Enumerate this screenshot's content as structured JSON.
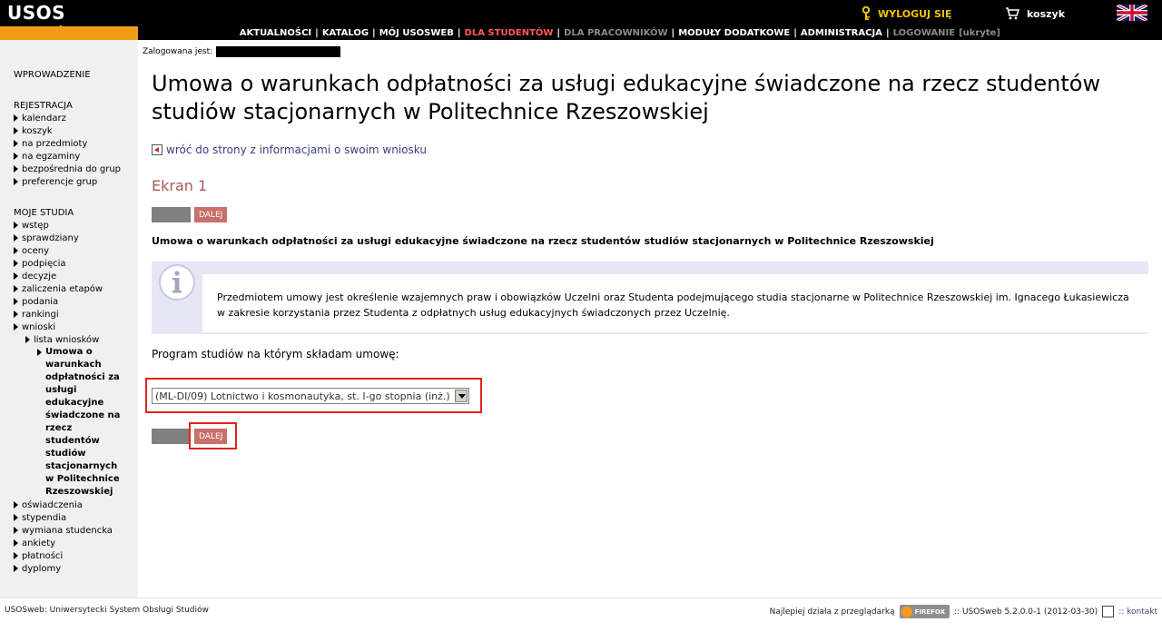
{
  "header": {
    "logo_main": "USOS",
    "logo_sub": "web",
    "logout_label": "WYLOGUJ SIĘ",
    "cart_label": "koszyk",
    "nav": [
      {
        "label": "AKTUALNOŚCI"
      },
      {
        "label": "KATALOG"
      },
      {
        "label": "MÓJ USOSWEB"
      },
      {
        "label": "DLA STUDENTÓW"
      },
      {
        "label": "DLA PRACOWNIKÓW"
      },
      {
        "label": "MODUŁY DODATKOWE"
      },
      {
        "label": "ADMINISTRACJA"
      },
      {
        "label": "LOGOWANIE"
      }
    ],
    "nav_hidden_tag": "[ukryte]",
    "colors": {
      "accent": "#f29b18",
      "active": "#ff5a5a",
      "inactive": "#8a8a8a"
    }
  },
  "sidebar": {
    "intro": "WPROWADZENIE",
    "registration_header": "REJESTRACJA",
    "registration_items": [
      "kalendarz",
      "koszyk",
      "na przedmioty",
      "na egzaminy",
      "bezpośrednia do grup",
      "preferencje grup"
    ],
    "studies_header": "MOJE STUDIA",
    "studies_items": [
      "wstęp",
      "sprawdziany",
      "oceny",
      "podpięcia",
      "decyzje",
      "zaliczenia etapów",
      "podania",
      "rankingi",
      "wnioski"
    ],
    "sub_item": "lista wniosków",
    "current_lines": [
      "Umowa o",
      "warunkach",
      "odpłatności za",
      "usługi",
      "edukacyjne",
      "świadczone na",
      "rzecz",
      "studentów",
      "studiów",
      "stacjonarnych",
      "w Politechnice",
      "Rzeszowskiej"
    ],
    "after_items": [
      "oświadczenia",
      "stypendia",
      "wymiana studencka",
      "ankiety",
      "płatności",
      "dyplomy"
    ]
  },
  "main": {
    "logged_label": "Zalogowana jest:",
    "title": "Umowa o warunkach odpłatności za usługi edukacyjne świadczone na rzecz studentów studiów stacjonarnych w Politechnice Rzeszowskiej",
    "back_link": "wróć do strony z informacjami o swoim wniosku",
    "screen_heading": "Ekran 1",
    "next_label": "DALEJ",
    "subtitle": "Umowa o warunkach odpłatności za usługi edukacyjne świadczone na rzecz studentów studiów stacjonarnych w Politechnice Rzeszowskiej",
    "info_text": "Przedmiotem umowy jest określenie wzajemnych praw i obowiązków Uczelni oraz Studenta podejmującego studia stacjonarne w Politechnice Rzeszowskiej im. Ignacego Łukasiewicza w zakresie korzystania przez Studenta z odpłatnych usług edukacyjnych świadczonych przez Uczelnię.",
    "program_label": "Program studiów na którym składam umowę:",
    "program_selected": "(ML-DI/09) Lotnictwo i kosmonautyka, st. I-go stopnia (inż.)"
  },
  "footer": {
    "left": "USOSweb: Uniwersytecki System Obsługi Studiów",
    "best_with": "Najlepiej działa z przeglądarką",
    "firefox_badge": "FIREFOX",
    "version": ":: USOSweb 5.2.0.0-1 (2012-03-30)",
    "contact": ":: kontakt"
  }
}
